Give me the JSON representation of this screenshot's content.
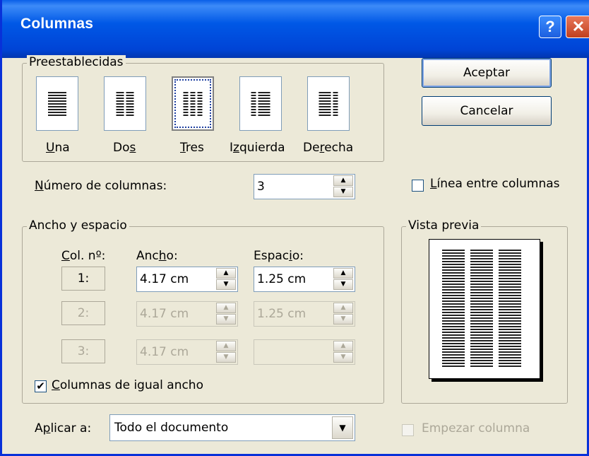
{
  "window": {
    "title": "Columnas",
    "help_label": "?",
    "close_label": "✕"
  },
  "presets": {
    "group_label": "Preestablecidas",
    "items": [
      {
        "label": "Una",
        "key": "U",
        "rest": "na",
        "pre": ""
      },
      {
        "label": "Dos",
        "pre": "Do",
        "key": "s",
        "rest": ""
      },
      {
        "label": "Tres",
        "pre": "",
        "key": "T",
        "rest": "res"
      },
      {
        "label": "Izquierda",
        "pre": "I",
        "key": "z",
        "rest": "quierda"
      },
      {
        "label": "Derecha",
        "pre": "De",
        "key": "r",
        "rest": "echa"
      }
    ],
    "selected": "Tres"
  },
  "buttons": {
    "ok": "Aceptar",
    "cancel": "Cancelar"
  },
  "num_columns": {
    "label_key": "N",
    "label_rest": "úmero de columnas:",
    "value": "3"
  },
  "line_between": {
    "pre": "",
    "key": "L",
    "rest": "ínea entre columnas",
    "checked": false
  },
  "width_spacing": {
    "group_label": "Ancho y espacio",
    "col_header_key": "C",
    "col_header_rest": "ol. nº:",
    "width_header_pre": "Anc",
    "width_header_key": "h",
    "width_header_rest": "o:",
    "spacing_header_pre": "Espac",
    "spacing_header_key": "i",
    "spacing_header_rest": "o:",
    "rows": [
      {
        "col": "1:",
        "width": "4.17 cm",
        "spacing": "1.25 cm",
        "enabled": true
      },
      {
        "col": "2:",
        "width": "4.17 cm",
        "spacing": "1.25 cm",
        "enabled": false
      },
      {
        "col": "3:",
        "width": "4.17 cm",
        "spacing": "",
        "enabled": false
      }
    ],
    "equal_width": {
      "key": "C",
      "rest": "olumnas de igual ancho",
      "checked": true
    }
  },
  "preview": {
    "group_label": "Vista previa"
  },
  "apply_to": {
    "pre": "A",
    "key": "p",
    "rest": "licar a:",
    "value": "Todo el documento"
  },
  "start_column": {
    "label": "Empezar columna",
    "checked": false,
    "enabled": false
  },
  "colors": {
    "title_bar": "#0058e6",
    "dialog_bg": "#ece9d8",
    "disabled_text": "#aca899"
  }
}
